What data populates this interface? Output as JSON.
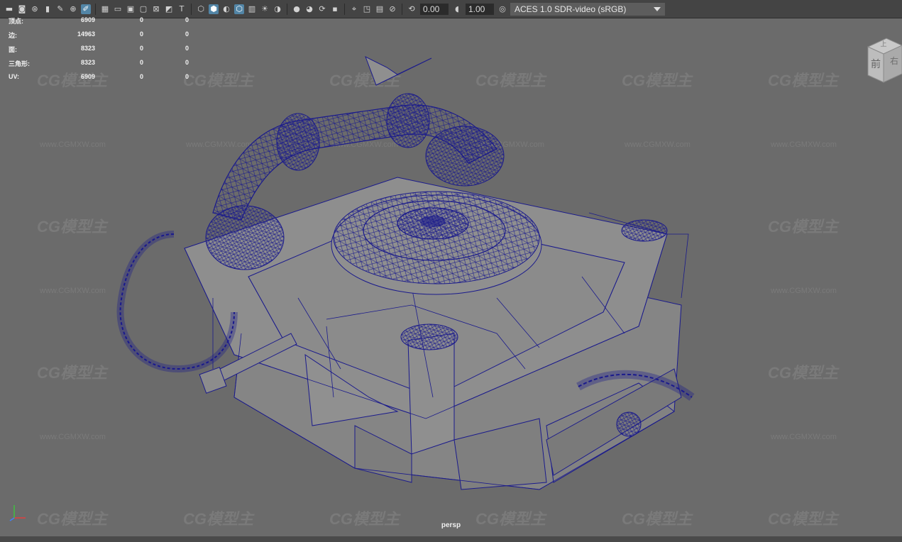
{
  "toolbar": {
    "exposure_value": "0.00",
    "gamma_value": "1.00",
    "colorspace_label": "ACES 1.0 SDR-video (sRGB)",
    "icons": [
      "camera-icon",
      "camera-attribute-icon",
      "film-gate-icon",
      "bookmark-icon",
      "image-plane-icon",
      "grease-pencil-icon",
      "grid-icon",
      "film-gate-toggle-icon",
      "resolution-gate-icon",
      "gate-mask-icon",
      "field-chart-icon",
      "safe-action-icon",
      "safe-title-icon",
      "wireframe-icon",
      "smooth-shade-icon",
      "default-material-icon",
      "wireframe-on-shaded-icon",
      "xray-icon",
      "lighting-icon",
      "shadows-icon",
      "screen-space-ao-icon",
      "motion-blur-icon",
      "anti-alias-icon",
      "depth-of-field-icon",
      "isolate-select-icon",
      "xray-joints-icon",
      "xray-active-icon",
      "backface-icon",
      "exposure-icon",
      "gamma-icon",
      "color-management-icon"
    ]
  },
  "hud": {
    "rows": [
      {
        "label": "顶点:",
        "v1": "6909",
        "v2": "0",
        "v3": "0"
      },
      {
        "label": "边:",
        "v1": "14963",
        "v2": "0",
        "v3": "0"
      },
      {
        "label": "面:",
        "v1": "8323",
        "v2": "0",
        "v3": "0"
      },
      {
        "label": "三角形:",
        "v1": "8323",
        "v2": "0",
        "v3": "0"
      },
      {
        "label": "UV:",
        "v1": "6909",
        "v2": "0",
        "v3": "0"
      }
    ]
  },
  "viewcube": {
    "front_label": "前",
    "right_label": "右",
    "top_label": "上"
  },
  "camera_label": "persp",
  "watermark": {
    "logo": "CG模型主",
    "url": "www.CGMXW.com"
  },
  "colors": {
    "viewport_bg": "#6b6b6b",
    "wire": "#1a1a8c",
    "toolbar_bg": "#444444",
    "active_icon": "#5285a6"
  }
}
